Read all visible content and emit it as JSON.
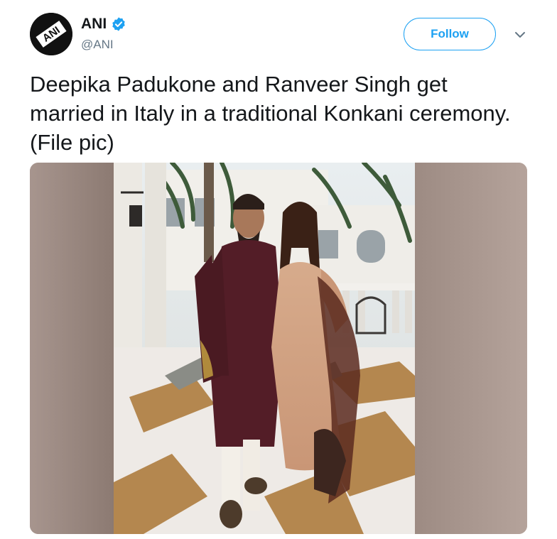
{
  "author": {
    "display_name": "ANI",
    "handle": "@ANI",
    "avatar_text": "ANI",
    "verified": true
  },
  "actions": {
    "follow_label": "Follow",
    "more_icon": "chevron-down-icon"
  },
  "tweet": {
    "text": "Deepika Padukone and Ranveer Singh get married in Italy in a traditional Konkani ceremony. (File pic)"
  },
  "media": {
    "kind": "photo"
  },
  "colors": {
    "accent": "#1da1f2",
    "text": "#14171a",
    "secondary_text": "#657786"
  }
}
